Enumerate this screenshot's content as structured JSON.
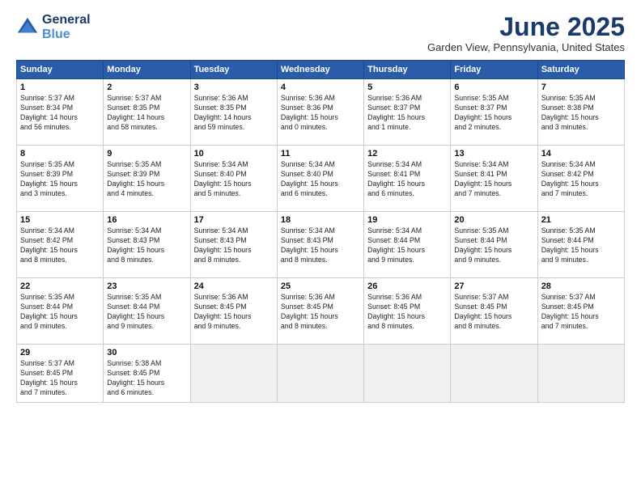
{
  "header": {
    "logo_line1": "General",
    "logo_line2": "Blue",
    "month": "June 2025",
    "location": "Garden View, Pennsylvania, United States"
  },
  "days_of_week": [
    "Sunday",
    "Monday",
    "Tuesday",
    "Wednesday",
    "Thursday",
    "Friday",
    "Saturday"
  ],
  "weeks": [
    [
      {
        "day": "1",
        "info": "Sunrise: 5:37 AM\nSunset: 8:34 PM\nDaylight: 14 hours\nand 56 minutes."
      },
      {
        "day": "2",
        "info": "Sunrise: 5:37 AM\nSunset: 8:35 PM\nDaylight: 14 hours\nand 58 minutes."
      },
      {
        "day": "3",
        "info": "Sunrise: 5:36 AM\nSunset: 8:35 PM\nDaylight: 14 hours\nand 59 minutes."
      },
      {
        "day": "4",
        "info": "Sunrise: 5:36 AM\nSunset: 8:36 PM\nDaylight: 15 hours\nand 0 minutes."
      },
      {
        "day": "5",
        "info": "Sunrise: 5:36 AM\nSunset: 8:37 PM\nDaylight: 15 hours\nand 1 minute."
      },
      {
        "day": "6",
        "info": "Sunrise: 5:35 AM\nSunset: 8:37 PM\nDaylight: 15 hours\nand 2 minutes."
      },
      {
        "day": "7",
        "info": "Sunrise: 5:35 AM\nSunset: 8:38 PM\nDaylight: 15 hours\nand 3 minutes."
      }
    ],
    [
      {
        "day": "8",
        "info": "Sunrise: 5:35 AM\nSunset: 8:39 PM\nDaylight: 15 hours\nand 3 minutes."
      },
      {
        "day": "9",
        "info": "Sunrise: 5:35 AM\nSunset: 8:39 PM\nDaylight: 15 hours\nand 4 minutes."
      },
      {
        "day": "10",
        "info": "Sunrise: 5:34 AM\nSunset: 8:40 PM\nDaylight: 15 hours\nand 5 minutes."
      },
      {
        "day": "11",
        "info": "Sunrise: 5:34 AM\nSunset: 8:40 PM\nDaylight: 15 hours\nand 6 minutes."
      },
      {
        "day": "12",
        "info": "Sunrise: 5:34 AM\nSunset: 8:41 PM\nDaylight: 15 hours\nand 6 minutes."
      },
      {
        "day": "13",
        "info": "Sunrise: 5:34 AM\nSunset: 8:41 PM\nDaylight: 15 hours\nand 7 minutes."
      },
      {
        "day": "14",
        "info": "Sunrise: 5:34 AM\nSunset: 8:42 PM\nDaylight: 15 hours\nand 7 minutes."
      }
    ],
    [
      {
        "day": "15",
        "info": "Sunrise: 5:34 AM\nSunset: 8:42 PM\nDaylight: 15 hours\nand 8 minutes."
      },
      {
        "day": "16",
        "info": "Sunrise: 5:34 AM\nSunset: 8:43 PM\nDaylight: 15 hours\nand 8 minutes."
      },
      {
        "day": "17",
        "info": "Sunrise: 5:34 AM\nSunset: 8:43 PM\nDaylight: 15 hours\nand 8 minutes."
      },
      {
        "day": "18",
        "info": "Sunrise: 5:34 AM\nSunset: 8:43 PM\nDaylight: 15 hours\nand 8 minutes."
      },
      {
        "day": "19",
        "info": "Sunrise: 5:34 AM\nSunset: 8:44 PM\nDaylight: 15 hours\nand 9 minutes."
      },
      {
        "day": "20",
        "info": "Sunrise: 5:35 AM\nSunset: 8:44 PM\nDaylight: 15 hours\nand 9 minutes."
      },
      {
        "day": "21",
        "info": "Sunrise: 5:35 AM\nSunset: 8:44 PM\nDaylight: 15 hours\nand 9 minutes."
      }
    ],
    [
      {
        "day": "22",
        "info": "Sunrise: 5:35 AM\nSunset: 8:44 PM\nDaylight: 15 hours\nand 9 minutes."
      },
      {
        "day": "23",
        "info": "Sunrise: 5:35 AM\nSunset: 8:44 PM\nDaylight: 15 hours\nand 9 minutes."
      },
      {
        "day": "24",
        "info": "Sunrise: 5:36 AM\nSunset: 8:45 PM\nDaylight: 15 hours\nand 9 minutes."
      },
      {
        "day": "25",
        "info": "Sunrise: 5:36 AM\nSunset: 8:45 PM\nDaylight: 15 hours\nand 8 minutes."
      },
      {
        "day": "26",
        "info": "Sunrise: 5:36 AM\nSunset: 8:45 PM\nDaylight: 15 hours\nand 8 minutes."
      },
      {
        "day": "27",
        "info": "Sunrise: 5:37 AM\nSunset: 8:45 PM\nDaylight: 15 hours\nand 8 minutes."
      },
      {
        "day": "28",
        "info": "Sunrise: 5:37 AM\nSunset: 8:45 PM\nDaylight: 15 hours\nand 7 minutes."
      }
    ],
    [
      {
        "day": "29",
        "info": "Sunrise: 5:37 AM\nSunset: 8:45 PM\nDaylight: 15 hours\nand 7 minutes."
      },
      {
        "day": "30",
        "info": "Sunrise: 5:38 AM\nSunset: 8:45 PM\nDaylight: 15 hours\nand 6 minutes."
      },
      {
        "day": "",
        "info": ""
      },
      {
        "day": "",
        "info": ""
      },
      {
        "day": "",
        "info": ""
      },
      {
        "day": "",
        "info": ""
      },
      {
        "day": "",
        "info": ""
      }
    ]
  ]
}
